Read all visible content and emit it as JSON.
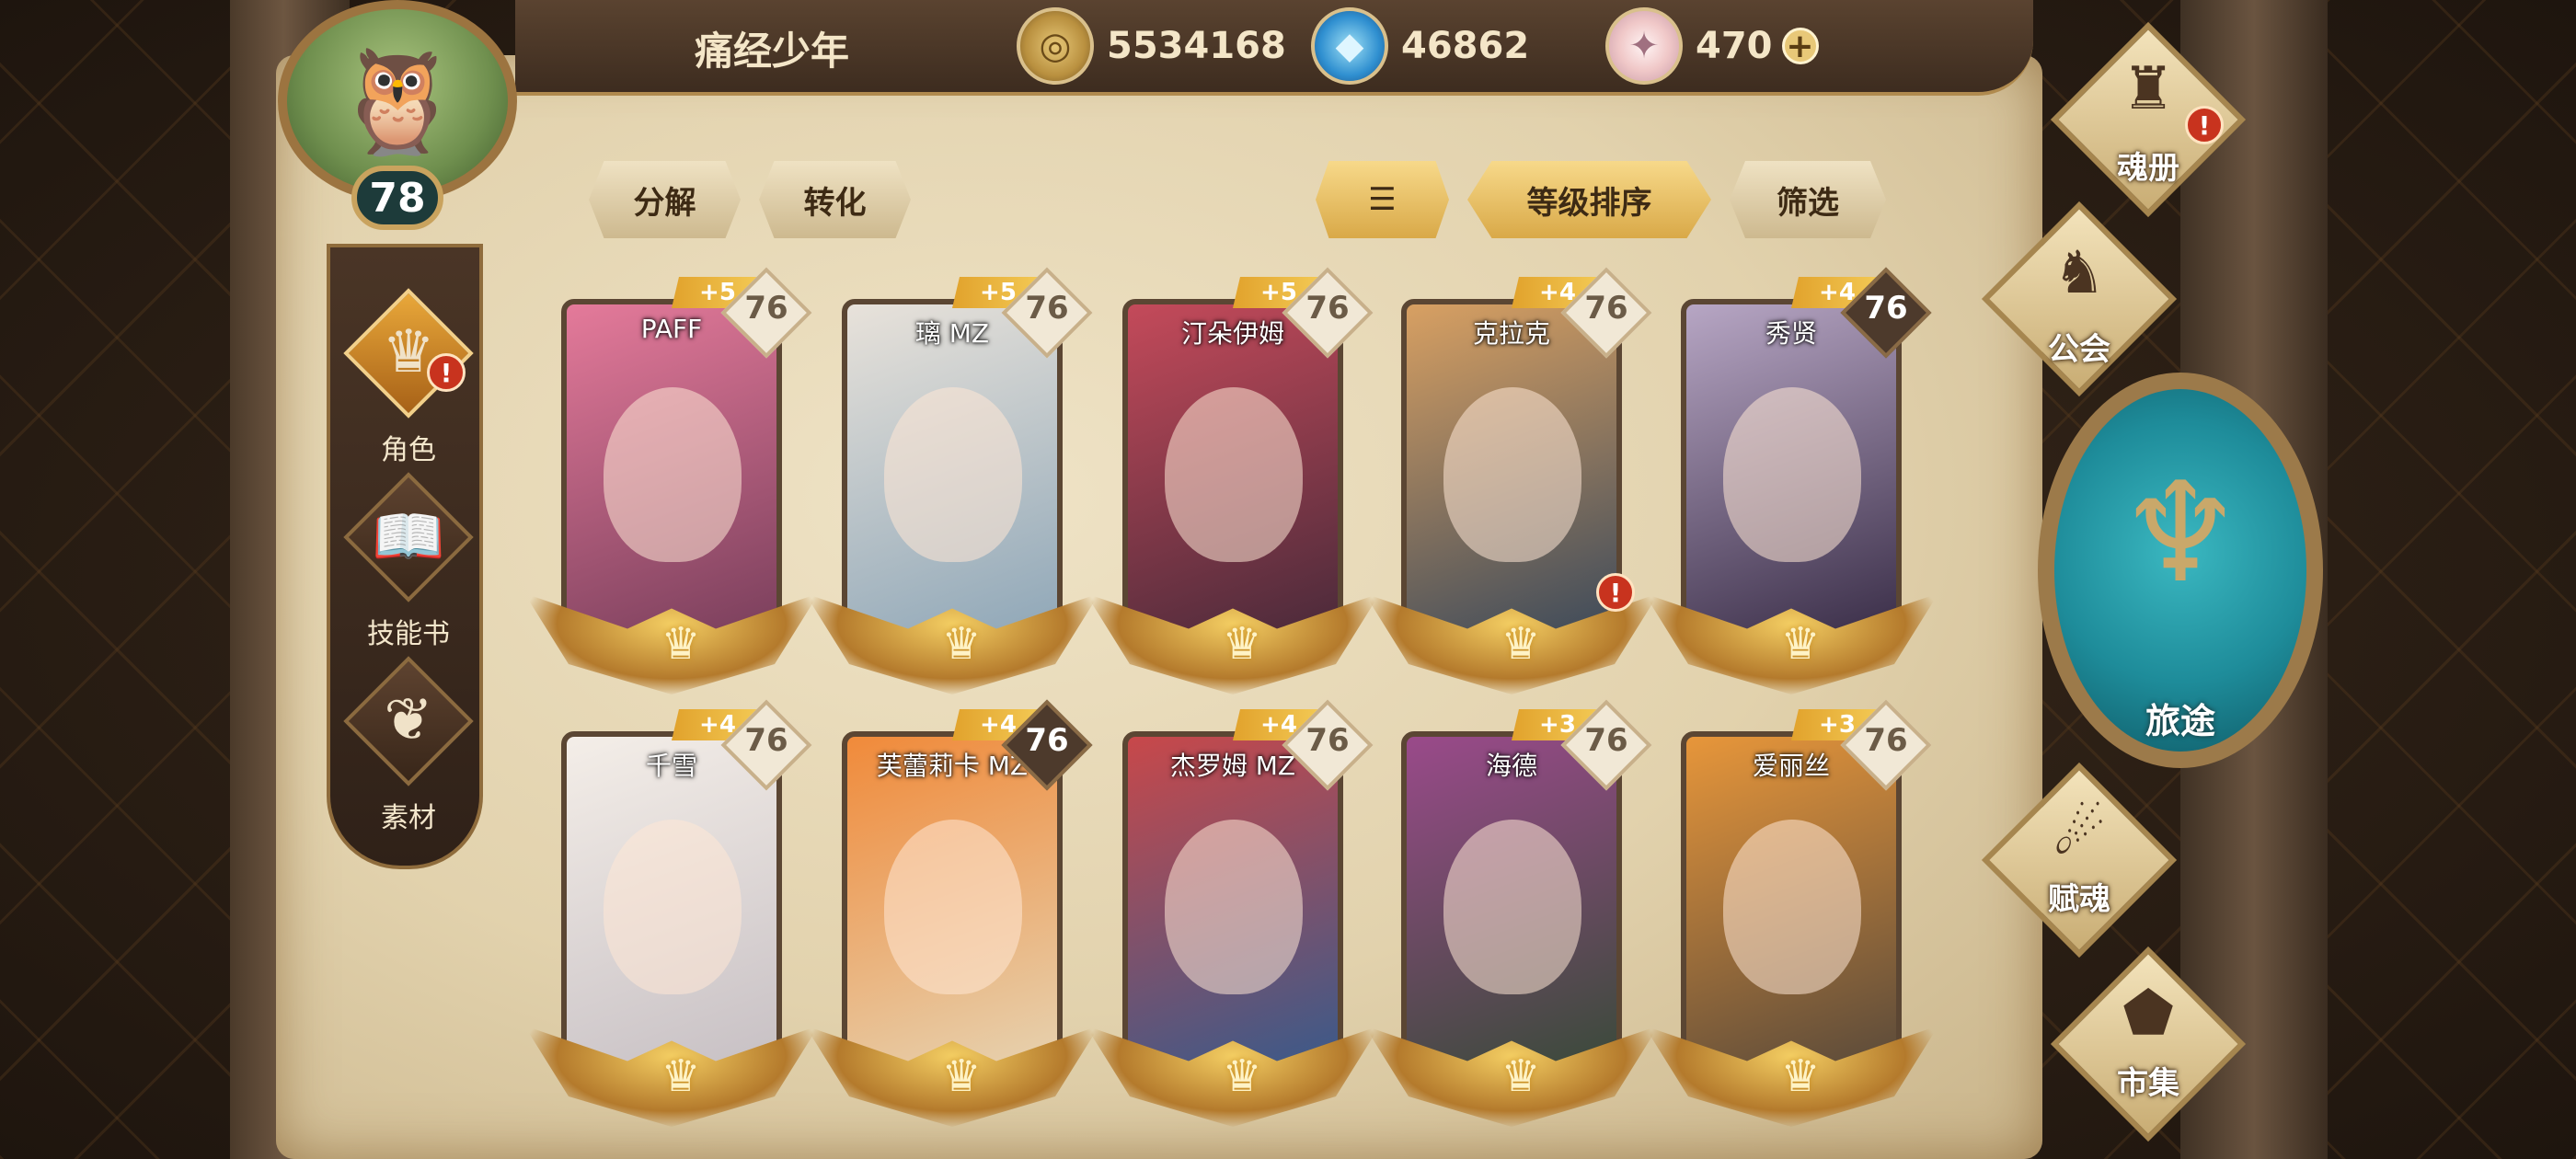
{
  "header": {
    "player_name": "痛经少年",
    "currencies": [
      {
        "icon": "gold-coin-icon",
        "value": "5534168"
      },
      {
        "icon": "blue-crystal-icon",
        "value": "46862"
      },
      {
        "icon": "prism-gem-icon",
        "value": "470"
      }
    ],
    "add_icon": "plus-icon"
  },
  "player": {
    "avatar_icon": "owl-avatar-icon",
    "level": "78"
  },
  "sidebar": {
    "items": [
      {
        "label": "角色",
        "icon": "character-icon",
        "active": true,
        "alert": "!"
      },
      {
        "label": "技能书",
        "icon": "skill-book-icon",
        "active": false
      },
      {
        "label": "素材",
        "icon": "material-icon",
        "active": false
      }
    ]
  },
  "toolbar": {
    "decompose": "分解",
    "convert": "转化",
    "sort_icon": "sort-icon",
    "sort_label": "等级排序",
    "filter": "筛选"
  },
  "cards": [
    {
      "name": "PAFF",
      "plus": "+5",
      "level": "76",
      "dark": false,
      "colors": [
        "#e47a9a",
        "#7a3f5c"
      ]
    },
    {
      "name": "璃 MZ",
      "plus": "+5",
      "level": "76",
      "dark": false,
      "colors": [
        "#e8e2da",
        "#8fa7b8"
      ]
    },
    {
      "name": "汀朵伊姆",
      "plus": "+5",
      "level": "76",
      "dark": false,
      "colors": [
        "#c44a5a",
        "#4a2a3a"
      ]
    },
    {
      "name": "克拉克",
      "plus": "+4",
      "level": "76",
      "dark": false,
      "alert": "!",
      "colors": [
        "#d8a062",
        "#3d4a5a"
      ]
    },
    {
      "name": "秀贤",
      "plus": "+4",
      "level": "76",
      "dark": true,
      "colors": [
        "#b7a6c4",
        "#3a2e48"
      ]
    },
    {
      "name": "千雪",
      "plus": "+4",
      "level": "76",
      "dark": false,
      "colors": [
        "#f4eee8",
        "#c7c0c4"
      ]
    },
    {
      "name": "芙蕾莉卡 MZ",
      "plus": "+4",
      "level": "76",
      "dark": true,
      "colors": [
        "#f08a3a",
        "#e6d2b0"
      ]
    },
    {
      "name": "杰罗姆 MZ",
      "plus": "+4",
      "level": "76",
      "dark": false,
      "colors": [
        "#c8484a",
        "#3a5a8a"
      ]
    },
    {
      "name": "海德",
      "plus": "+3",
      "level": "76",
      "dark": false,
      "colors": [
        "#9a4a8a",
        "#3a4a3a"
      ]
    },
    {
      "name": "爱丽丝",
      "plus": "+3",
      "level": "76",
      "dark": false,
      "colors": [
        "#e7963a",
        "#5a4a3a"
      ]
    }
  ],
  "right_nav": {
    "items": [
      {
        "label": "魂册",
        "icon": "soul-book-icon",
        "alert": "!"
      },
      {
        "label": "公会",
        "icon": "guild-icon"
      },
      {
        "label": "赋魂",
        "icon": "ensoul-icon"
      },
      {
        "label": "市集",
        "icon": "market-icon"
      }
    ],
    "journey": {
      "label": "旅途",
      "icon": "journey-trident-icon"
    }
  },
  "colors": {
    "accent_gold": "#f4cb56",
    "alert_red": "#c8331e",
    "journey_teal": "#1e8c9a"
  }
}
